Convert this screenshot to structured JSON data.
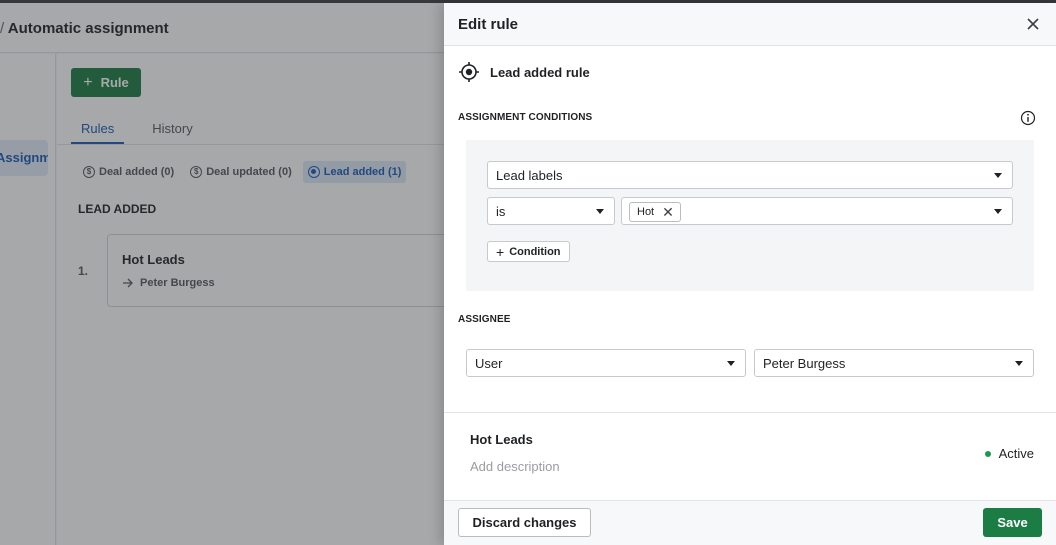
{
  "background": {
    "breadcrumb_separator": "/",
    "page_title": "Automatic assignment",
    "sidebar_item": "Assignment",
    "add_rule_label": "Rule",
    "tabs": [
      {
        "label": "Rules",
        "active": true
      },
      {
        "label": "History",
        "active": false
      }
    ],
    "filters": [
      {
        "label": "Deal added (0)",
        "icon": "coin-icon"
      },
      {
        "label": "Deal updated (0)",
        "icon": "coin-icon"
      },
      {
        "label": "Lead added (1)",
        "icon": "target-icon"
      }
    ],
    "section_title": "LEAD ADDED",
    "rule_row": {
      "number": "1.",
      "title": "Hot Leads",
      "assignee": "Peter Burgess"
    }
  },
  "panel": {
    "title": "Edit rule",
    "rule_type": "Lead added rule",
    "conditions_label": "ASSIGNMENT CONDITIONS",
    "condition": {
      "field": "Lead labels",
      "operator": "is",
      "value_chip": "Hot"
    },
    "add_condition_label": "Condition",
    "assignee_label": "ASSIGNEE",
    "assignee_type": "User",
    "assignee_user": "Peter Burgess",
    "rule_name": "Hot Leads",
    "description_placeholder": "Add description",
    "status": "Active",
    "status_color": "#1b9a4f",
    "discard_label": "Discard changes",
    "save_label": "Save"
  },
  "colors": {
    "primary_green": "#1b7d43",
    "link_blue": "#1a5bb5"
  }
}
